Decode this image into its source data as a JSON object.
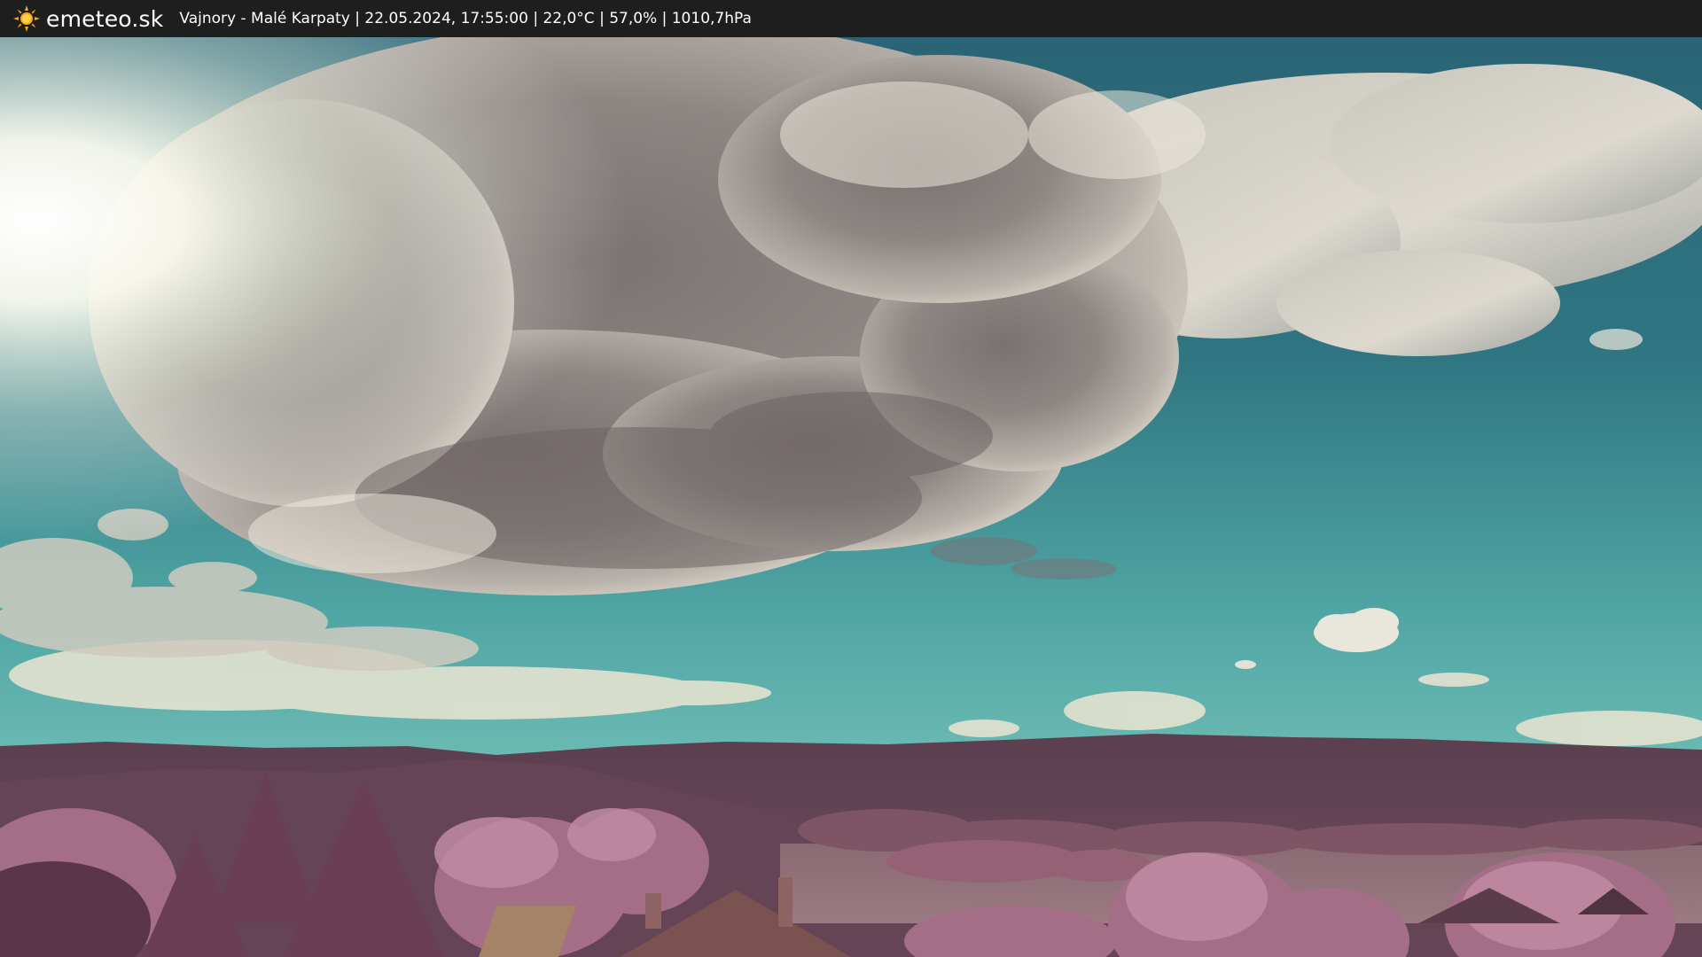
{
  "header": {
    "logo_icon": "sun-icon",
    "brand": "emeteo.sk",
    "info": "Vajnory - Malé Karpaty | 22.05.2024, 17:55:00 | 22,0°C | 57,0% | 1010,7hPa"
  },
  "colors": {
    "bar_background": "#1e1e1e",
    "sun": "#f5a81c",
    "sky_top": "#2f6f7f",
    "sky_horizon": "#5fb3b0",
    "cloud": "#9a9390",
    "hills": "#5a3e4c",
    "foliage": "#b57b96"
  }
}
